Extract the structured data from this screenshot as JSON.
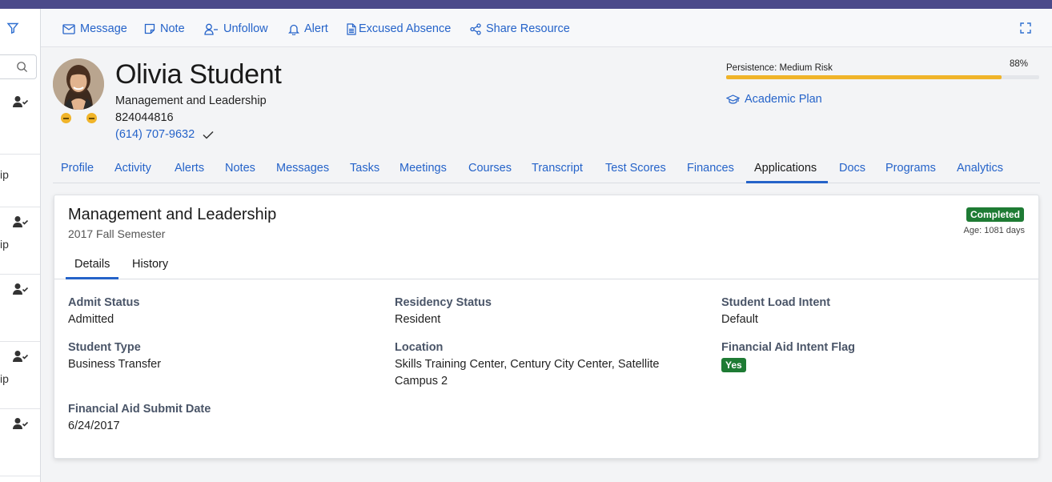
{
  "actions": {
    "message": "Message",
    "note": "Note",
    "unfollow": "Unfollow",
    "alert": "Alert",
    "excused_absence": "Excused Absence",
    "share_resource": "Share Resource"
  },
  "sidebar": {
    "list_fragments": [
      "",
      "ip",
      "ip",
      "",
      "ip",
      ""
    ]
  },
  "student": {
    "name": "Olivia Student",
    "program": "Management and Leadership",
    "id": "824044816",
    "phone": "(614) 707-9632"
  },
  "persistence": {
    "label": "Persistence: Medium Risk",
    "percent_text": "88%",
    "value": 0.88
  },
  "academic_plan": "Academic Plan",
  "tabs": [
    "Profile",
    "Activity",
    "Alerts",
    "Notes",
    "Messages",
    "Tasks",
    "Meetings",
    "Courses",
    "Transcript",
    "Test Scores",
    "Finances",
    "Applications",
    "Docs",
    "Programs",
    "Analytics"
  ],
  "active_tab": "Applications",
  "application": {
    "title": "Management and Leadership",
    "term": "2017 Fall Semester",
    "status_badge": "Completed",
    "age": "Age: 1081 days",
    "subtabs": [
      "Details",
      "History"
    ],
    "fields": {
      "admit_status": {
        "label": "Admit Status",
        "value": "Admitted"
      },
      "residency_status": {
        "label": "Residency Status",
        "value": "Resident"
      },
      "student_load_intent": {
        "label": "Student Load Intent",
        "value": "Default"
      },
      "student_type": {
        "label": "Student Type",
        "value": "Business Transfer"
      },
      "location": {
        "label": "Location",
        "value_line1": "Skills Training Center, Century City Center, Satellite",
        "value_line2": "Campus 2"
      },
      "financial_aid_intent_flag": {
        "label": "Financial Aid Intent Flag",
        "value": "Yes"
      },
      "financial_aid_submit_date": {
        "label": "Financial Aid Submit Date",
        "value": "6/24/2017"
      }
    }
  },
  "colors": {
    "accent": "#2563c9",
    "topbar": "#4b4a8a",
    "success": "#1e7b34",
    "warning": "#f0b429"
  }
}
